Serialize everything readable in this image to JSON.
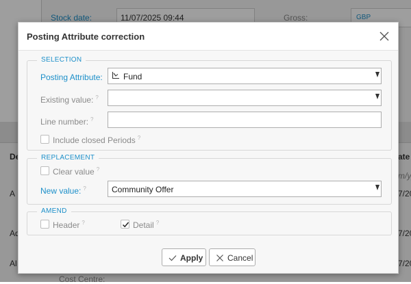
{
  "background": {
    "stock_date_label": "Stock date:",
    "stock_date_value": "11/07/2025 09:44",
    "gross_label": "Gross:",
    "currency": "GBP",
    "col_header_de": "De",
    "col_header_ate": "ate",
    "row_text_1": "A",
    "row_text_2": "Ad",
    "row_text_3": "Al",
    "date_fragment_1": "7/20",
    "date_fragment_2": "7/20",
    "date_fragment_3": "7/20",
    "date_fragment_placeholder": "m/yy",
    "cost_centre_label": "Cost Centre:"
  },
  "dialog": {
    "title": "Posting Attribute correction",
    "selection": {
      "title": "SELECTION",
      "posting_attribute_label": "Posting Attribute:",
      "posting_attribute_value": "Fund",
      "existing_value_label": "Existing value:",
      "existing_value": "",
      "line_number_label": "Line number:",
      "line_number_value": "",
      "include_closed_label": "Include closed Periods",
      "include_closed_checked": false
    },
    "replacement": {
      "title": "REPLACEMENT",
      "clear_value_label": "Clear value",
      "clear_value_checked": false,
      "new_value_label": "New value:",
      "new_value": "Community Offer"
    },
    "amend": {
      "title": "AMEND",
      "header_label": "Header",
      "header_checked": false,
      "detail_label": "Detail",
      "detail_checked": true
    },
    "buttons": {
      "apply": "Apply",
      "cancel": "Cancel"
    }
  },
  "colors": {
    "accent": "#1c8fc9",
    "muted_label": "#8a8a8a",
    "overlay": "rgba(0,0,0,0.38)"
  },
  "icons": {
    "close": "close-icon",
    "fund": "fund-chart-icon",
    "dropdown": "chevron-down-icon",
    "apply": "checkmark-icon",
    "cancel": "x-icon",
    "help": "help-question-icon"
  }
}
